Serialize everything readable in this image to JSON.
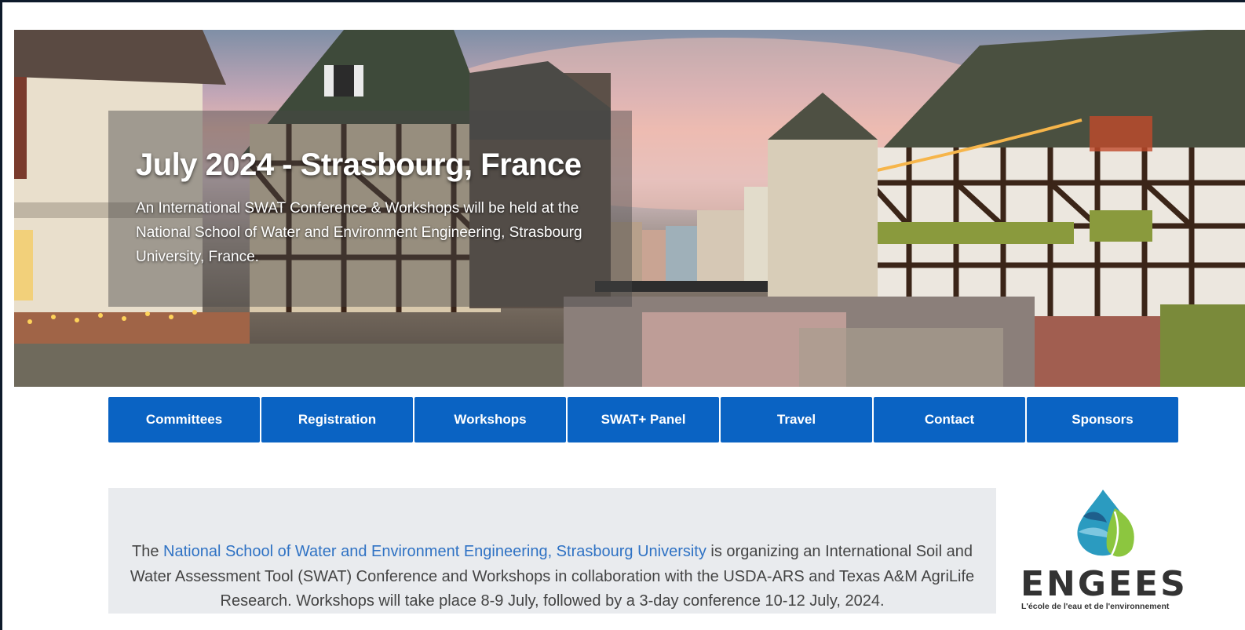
{
  "hero": {
    "title": "July 2024 - Strasbourg, France",
    "description": "An International SWAT Conference & Workshops will be held at the National School of Water and Environment Engineering, Strasbourg University, France."
  },
  "nav": [
    {
      "label": "Committees"
    },
    {
      "label": "Registration"
    },
    {
      "label": "Workshops"
    },
    {
      "label": "SWAT+ Panel"
    },
    {
      "label": "Travel"
    },
    {
      "label": "Contact"
    },
    {
      "label": "Sponsors"
    }
  ],
  "info": {
    "prefix": "The ",
    "link_text": "National School of Water and Environment Engineering, Strasbourg University",
    "suffix": " is organizing an International Soil and Water Assessment Tool (SWAT) Conference and Workshops in collaboration with the USDA-ARS and Texas A&M AgriLife Research. Workshops will take place 8-9 July, followed by a 3-day conference 10-12 July, 2024."
  },
  "logo": {
    "name": "ENGEES",
    "tagline": "L'école de l'eau et de l'environnement"
  },
  "colors": {
    "nav_button": "#0a63c3",
    "link": "#2f72c4",
    "info_background": "#e9ebee"
  }
}
